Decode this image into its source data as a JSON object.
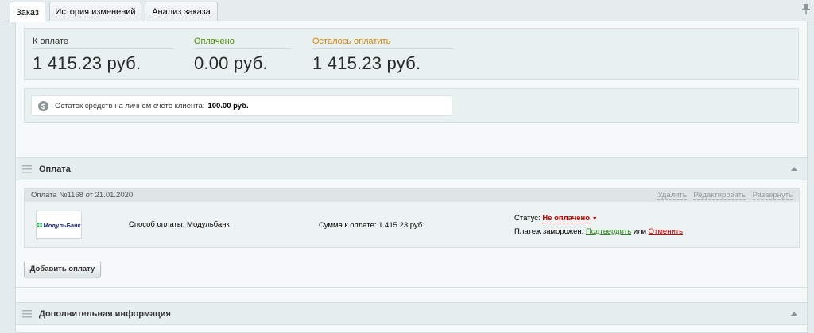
{
  "tabs": [
    {
      "label": "Заказ",
      "active": true
    },
    {
      "label": "История изменений",
      "active": false
    },
    {
      "label": "Анализ заказа",
      "active": false
    }
  ],
  "summary": {
    "to_pay_label": "К оплате",
    "to_pay_value": "1 415.23 руб.",
    "paid_label": "Оплачено",
    "paid_value": "0.00 руб.",
    "remaining_label": "Осталось оплатить",
    "remaining_value": "1 415.23 руб."
  },
  "balance": {
    "text": "Остаток средств на личном счете клиента:",
    "value": "100.00 руб."
  },
  "payment_section": {
    "title": "Оплата",
    "payment_header": "Оплата №1168 от 21.01.2020",
    "actions": [
      "Удалить",
      "Редактировать",
      "Развернуть"
    ],
    "logo_text": "МодульБанк",
    "method": "Способ оплаты: Модульбанк",
    "amount": "Сумма к оплате: 1 415.23 руб.",
    "status_label": "Статус:",
    "status_value": "Не оплачено",
    "frozen_text": "Платеж заморожен.",
    "confirm_link": "Подтвердить",
    "or_text": "или",
    "cancel_link": "Отменить",
    "add_button": "Добавить оплату"
  },
  "extra_section": {
    "title": "Дополнительная информация"
  },
  "colors": {
    "paid_label": "#4c8a00",
    "remaining_label": "#d6860a",
    "status_red": "#c50000",
    "confirm_green": "#2d8a1f"
  }
}
